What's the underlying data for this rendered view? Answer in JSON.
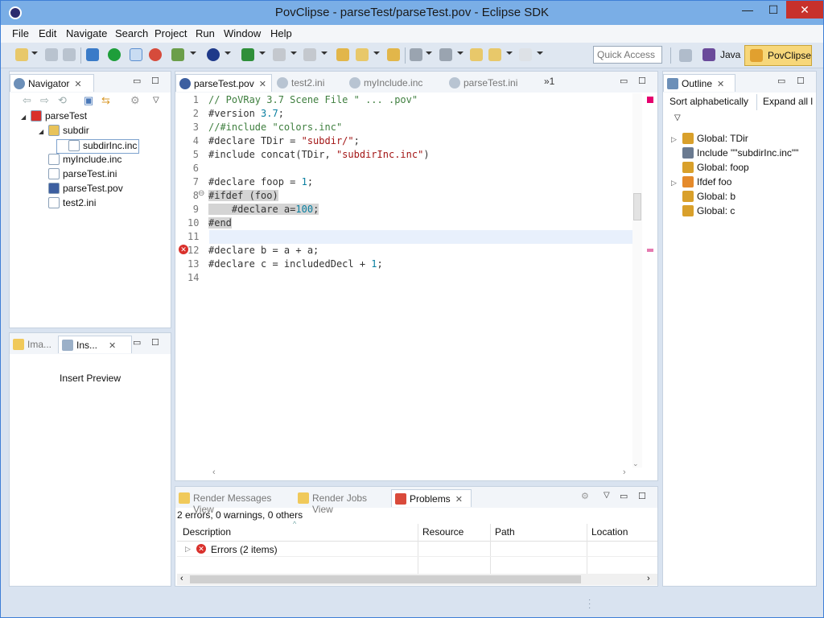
{
  "window": {
    "title": "PovClipse - parseTest/parseTest.pov - Eclipse SDK",
    "minimize": "—",
    "maximize": "☐",
    "close": "✕"
  },
  "menu": [
    "File",
    "Edit",
    "Navigate",
    "Search",
    "Project",
    "Run",
    "Window",
    "Help"
  ],
  "quick_access": {
    "placeholder": "Quick Access"
  },
  "perspectives": [
    {
      "label": "Java"
    },
    {
      "label": "PovClipse"
    }
  ],
  "navigator": {
    "title": "Navigator",
    "tree": [
      {
        "label": "parseTest",
        "level": 0,
        "expander": "◢",
        "icon": "project-icon"
      },
      {
        "label": "subdir",
        "level": 1,
        "expander": "◢",
        "icon": "folder-icon"
      },
      {
        "label": "subdirInc.inc",
        "level": 2,
        "expander": "",
        "icon": "file-icon",
        "selected": true
      },
      {
        "label": "myInclude.inc",
        "level": 1,
        "expander": "",
        "icon": "file-icon"
      },
      {
        "label": "parseTest.ini",
        "level": 1,
        "expander": "",
        "icon": "ini-icon"
      },
      {
        "label": "parseTest.pov",
        "level": 1,
        "expander": "",
        "icon": "pov-icon"
      },
      {
        "label": "test2.ini",
        "level": 1,
        "expander": "",
        "icon": "ini-icon"
      }
    ]
  },
  "lower_left": {
    "tabs": [
      "Ima...",
      "Ins..."
    ],
    "content": "Insert Preview"
  },
  "editor": {
    "tabs": [
      {
        "label": "parseTest.pov",
        "active": true
      },
      {
        "label": "test2.ini",
        "active": false
      },
      {
        "label": "myInclude.inc",
        "active": false
      },
      {
        "label": "parseTest.ini",
        "active": false
      }
    ],
    "overflow": "»1",
    "lines": [
      {
        "n": "1",
        "tokens": [
          {
            "t": "// PoVRay 3.7 Scene File \" ... .pov\"",
            "c": "cmt"
          }
        ]
      },
      {
        "n": "2",
        "tokens": [
          {
            "t": "#version ",
            "c": "kw"
          },
          {
            "t": "3.7",
            "c": "num"
          },
          {
            "t": ";",
            "c": "kw"
          }
        ]
      },
      {
        "n": "3",
        "tokens": [
          {
            "t": "//#include \"colors.inc\"",
            "c": "cmt"
          }
        ]
      },
      {
        "n": "4",
        "tokens": [
          {
            "t": "#declare TDir = ",
            "c": "kw"
          },
          {
            "t": "\"subdir/\"",
            "c": "str"
          },
          {
            "t": ";",
            "c": "kw"
          }
        ]
      },
      {
        "n": "5",
        "tokens": [
          {
            "t": "#include concat(TDir, ",
            "c": "kw"
          },
          {
            "t": "\"subdirInc.inc\"",
            "c": "str"
          },
          {
            "t": ")",
            "c": "kw"
          }
        ]
      },
      {
        "n": "6",
        "tokens": []
      },
      {
        "n": "7",
        "tokens": [
          {
            "t": "#declare foop = ",
            "c": "kw"
          },
          {
            "t": "1",
            "c": "num"
          },
          {
            "t": ";",
            "c": "kw"
          }
        ]
      },
      {
        "n": "8",
        "tokens": [
          {
            "t": "#ifdef (foo)",
            "c": "kw hl"
          }
        ]
      },
      {
        "n": "9",
        "tokens": [
          {
            "t": "    #declare a=",
            "c": "kw hl"
          },
          {
            "t": "100",
            "c": "num hl"
          },
          {
            "t": ";",
            "c": "kw hl"
          }
        ]
      },
      {
        "n": "10",
        "tokens": [
          {
            "t": "#end",
            "c": "kw hl"
          }
        ]
      },
      {
        "n": "11",
        "tokens": []
      },
      {
        "n": "12",
        "tokens": [
          {
            "t": "#declare b = a + a;",
            "c": "kw"
          }
        ]
      },
      {
        "n": "13",
        "tokens": [
          {
            "t": "#declare c = includedDecl + ",
            "c": "kw"
          },
          {
            "t": "1",
            "c": "num"
          },
          {
            "t": ";",
            "c": "kw"
          }
        ]
      },
      {
        "n": "14",
        "tokens": []
      }
    ]
  },
  "outline": {
    "title": "Outline",
    "sort": "Sort alphabetically",
    "expand": "Expand all l",
    "items": [
      {
        "label": "Global: TDir",
        "expander": "▷",
        "icon": "declare-icon"
      },
      {
        "label": "Include \"\"subdirInc.inc\"\"",
        "expander": "",
        "icon": "include-icon"
      },
      {
        "label": "Global: foop",
        "expander": "",
        "icon": "declare-icon"
      },
      {
        "label": "Ifdef foo",
        "expander": "▷",
        "icon": "ifdef-icon"
      },
      {
        "label": "Global: b",
        "expander": "",
        "icon": "declare-icon"
      },
      {
        "label": "Global: c",
        "expander": "",
        "icon": "declare-icon"
      }
    ]
  },
  "bottom": {
    "tabs": [
      {
        "label": "Render Messages View",
        "active": false
      },
      {
        "label": "Render Jobs View",
        "active": false
      },
      {
        "label": "Problems",
        "active": true
      }
    ],
    "summary": "2 errors, 0 warnings, 0 others",
    "columns": [
      "Description",
      "Resource",
      "Path",
      "Location"
    ],
    "rows": [
      {
        "description": "Errors (2 items)"
      }
    ]
  },
  "colors": {
    "accent": "#3f7fd6",
    "comment": "#3f7f3f",
    "string": "#a31515",
    "number": "#0a7fa0",
    "error": "#d9302b"
  }
}
